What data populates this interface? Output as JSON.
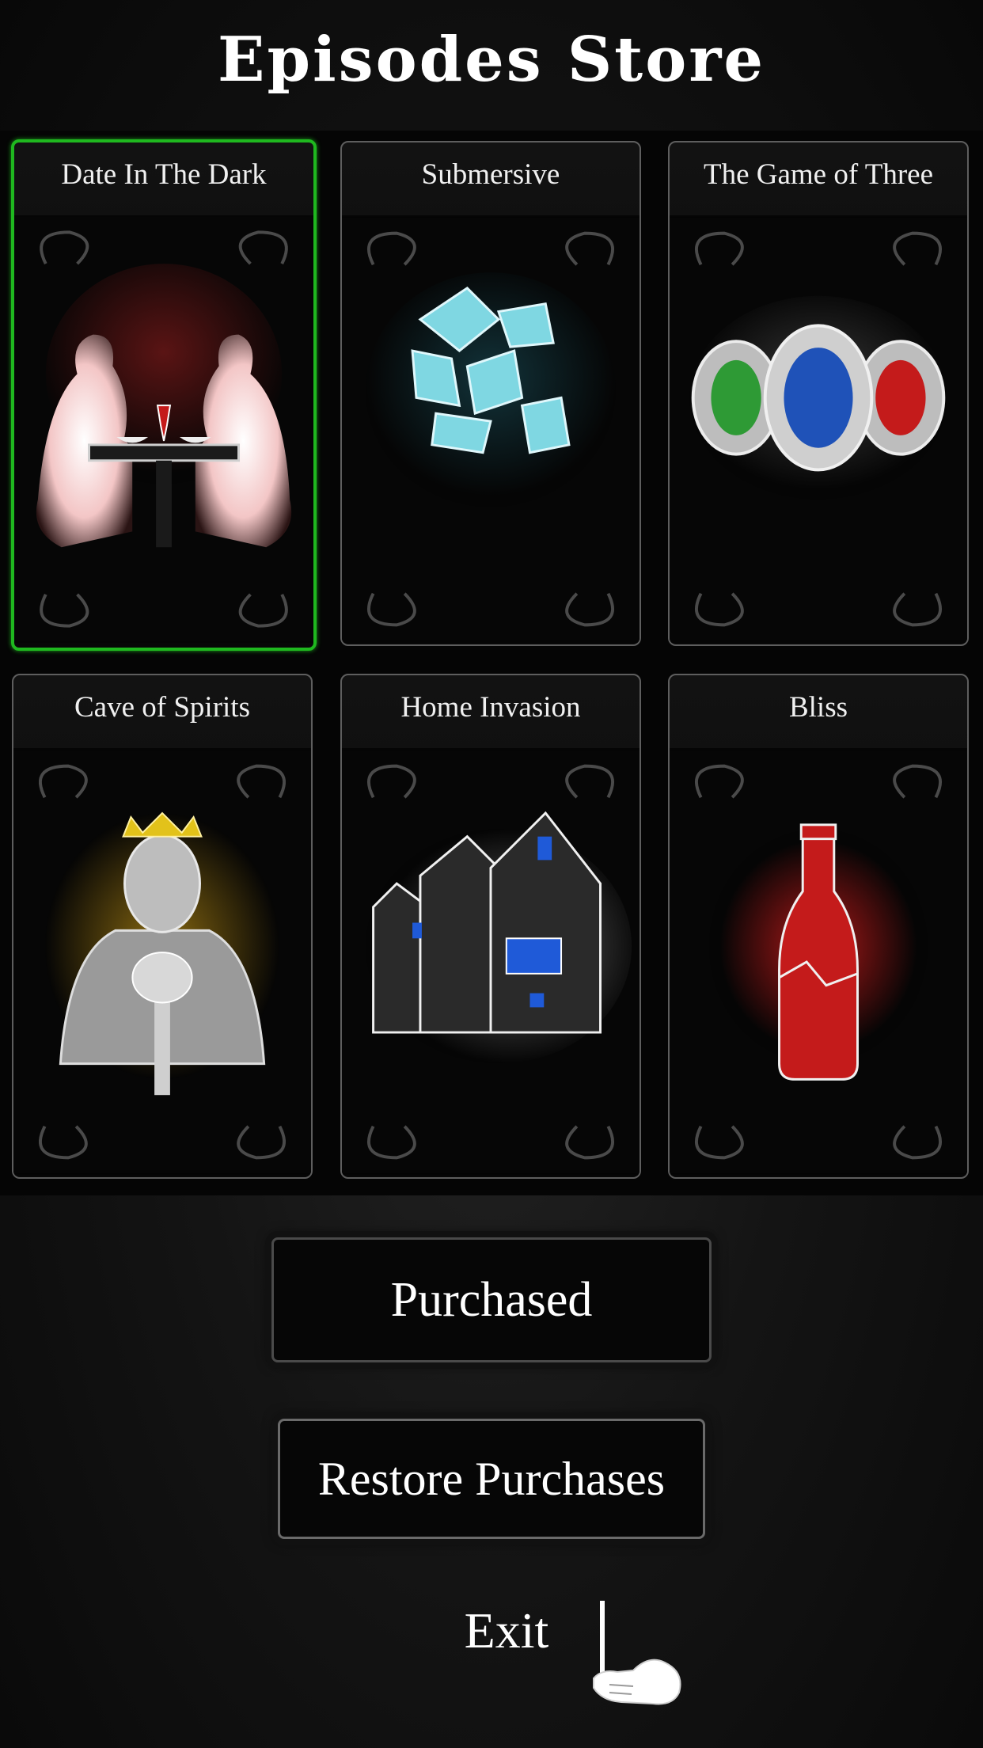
{
  "store": {
    "title": "Episodes Store"
  },
  "episodes": [
    {
      "title": "Date In The Dark",
      "selected": true,
      "art_icon": "couple-dinner-icon"
    },
    {
      "title": "Submersive",
      "selected": false,
      "art_icon": "ice-crystal-icon"
    },
    {
      "title": "The Game of Three",
      "selected": false,
      "art_icon": "three-gems-icon"
    },
    {
      "title": "Cave of Spirits",
      "selected": false,
      "art_icon": "crowned-warrior-icon"
    },
    {
      "title": "Home Invasion",
      "selected": false,
      "art_icon": "haunted-house-icon"
    },
    {
      "title": "Bliss",
      "selected": false,
      "art_icon": "red-bottle-icon"
    }
  ],
  "buttons": {
    "purchased_label": "Purchased",
    "restore_label": "Restore Purchases",
    "exit_label": "Exit"
  },
  "colors": {
    "selected_border": "#1fb81f",
    "card_border": "#5e5e5e",
    "background": "#0b0b0b"
  }
}
